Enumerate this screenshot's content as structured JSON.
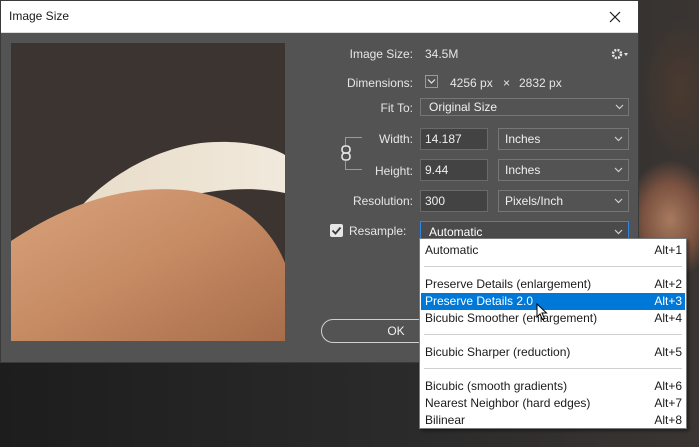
{
  "window": {
    "title": "Image Size"
  },
  "info": {
    "image_size_label": "Image Size:",
    "image_size_value": "34.5M",
    "dimensions_label": "Dimensions:",
    "dimensions_width": "4256 px",
    "dimensions_times": "×",
    "dimensions_height": "2832 px",
    "fit_to_label": "Fit To:",
    "fit_to_value": "Original Size"
  },
  "fields": {
    "width_label": "Width:",
    "width_value": "14.187",
    "width_unit": "Inches",
    "height_label": "Height:",
    "height_value": "9.44",
    "height_unit": "Inches",
    "resolution_label": "Resolution:",
    "resolution_value": "300",
    "resolution_unit": "Pixels/Inch",
    "resample_label": "Resample:",
    "resample_value": "Automatic",
    "resample_checked": true
  },
  "buttons": {
    "ok": "OK"
  },
  "resample_menu": [
    {
      "label": "Automatic",
      "shortcut": "Alt+1"
    },
    {
      "label": "Preserve Details (enlargement)",
      "shortcut": "Alt+2"
    },
    {
      "label": "Preserve Details 2.0",
      "shortcut": "Alt+3",
      "selected": true
    },
    {
      "label": "Bicubic Smoother (enlargement)",
      "shortcut": "Alt+4"
    },
    {
      "label": "Bicubic Sharper (reduction)",
      "shortcut": "Alt+5"
    },
    {
      "label": "Bicubic (smooth gradients)",
      "shortcut": "Alt+6"
    },
    {
      "label": "Nearest Neighbor (hard edges)",
      "shortcut": "Alt+7"
    },
    {
      "label": "Bilinear",
      "shortcut": "Alt+8"
    }
  ],
  "colors": {
    "dialog_bg": "#535353",
    "menu_highlight": "#0078d7",
    "focus_border": "#2e86de"
  },
  "icons": [
    "close-icon",
    "gear-icon",
    "chain-link-icon",
    "chevron-down-icon",
    "checkbox-checked-icon",
    "mouse-pointer-icon"
  ]
}
